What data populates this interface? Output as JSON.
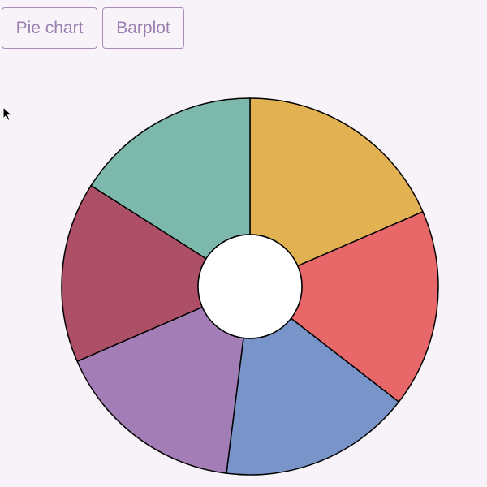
{
  "toolbar": {
    "pie_label": "Pie chart",
    "bar_label": "Barplot"
  },
  "cursor_icon": "arrow-cursor-icon",
  "chart_data": {
    "type": "pie",
    "donut": true,
    "slice_border_color": "#000000",
    "hole_color": "#ffffff",
    "slices": [
      {
        "value": 18.5,
        "color": "#e1b152"
      },
      {
        "value": 17.0,
        "color": "#e8686a"
      },
      {
        "value": 16.5,
        "color": "#7894c9"
      },
      {
        "value": 16.5,
        "color": "#a27db6"
      },
      {
        "value": 15.5,
        "color": "#ad5067"
      },
      {
        "value": 16.0,
        "color": "#7db8ad"
      }
    ]
  }
}
